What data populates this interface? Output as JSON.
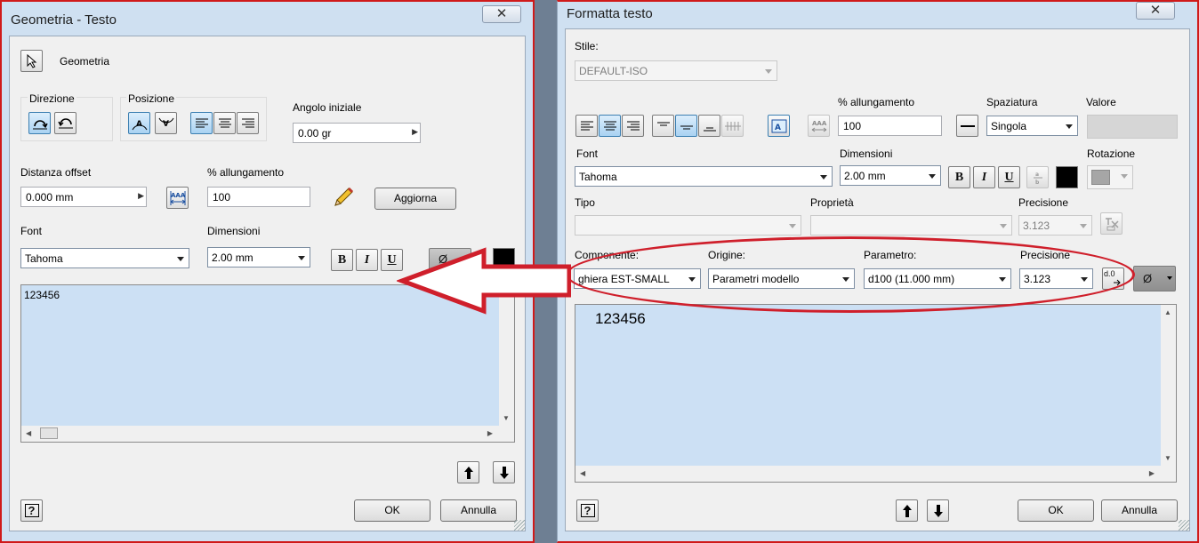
{
  "left": {
    "title": "Geometria - Testo",
    "close": "✕",
    "geometry_button": "Geometria",
    "direction_label": "Direzione",
    "position_label": "Posizione",
    "start_angle_label": "Angolo iniziale",
    "start_angle_value": "0.00 gr",
    "offset_label": "Distanza offset",
    "offset_value": "0.000 mm",
    "stretch_label": "% allungamento",
    "stretch_value": "100",
    "update_button": "Aggiorna",
    "font_label": "Font",
    "font_value": "Tahoma",
    "size_label": "Dimensioni",
    "size_value": "2.00 mm",
    "bold": "B",
    "italic": "I",
    "underline": "U",
    "symbol": "Ø",
    "text_content": "123456",
    "ok": "OK",
    "cancel": "Annulla",
    "help": "?"
  },
  "right": {
    "title": "Formatta testo",
    "close": "✕",
    "style_label": "Stile:",
    "style_value": "DEFAULT-ISO",
    "stretch_label": "% allungamento",
    "stretch_value": "100",
    "spacing_label": "Spaziatura",
    "spacing_value": "Singola",
    "value_label": "Valore",
    "font_label": "Font",
    "font_value": "Tahoma",
    "size_label": "Dimensioni",
    "size_value": "2.00 mm",
    "rotation_label": "Rotazione",
    "bold": "B",
    "italic": "I",
    "underline": "U",
    "type_label": "Tipo",
    "property_label": "Proprietà",
    "precision_label": "Precisione",
    "precision_value_disabled": "3.123",
    "component_label": "Componente:",
    "component_value": "ghiera EST-SMALL",
    "origin_label": "Origine:",
    "origin_value": "Parametri modello",
    "parameter_label": "Parametro:",
    "parameter_value": "d100 (11.000 mm)",
    "precision2_label": "Precisione",
    "precision2_value": "3.123",
    "precision_icon_text": "d.0",
    "symbol": "Ø",
    "text_content": "123456",
    "ok": "OK",
    "cancel": "Annulla",
    "help": "?"
  },
  "annotation_color": "#cf1f2b"
}
